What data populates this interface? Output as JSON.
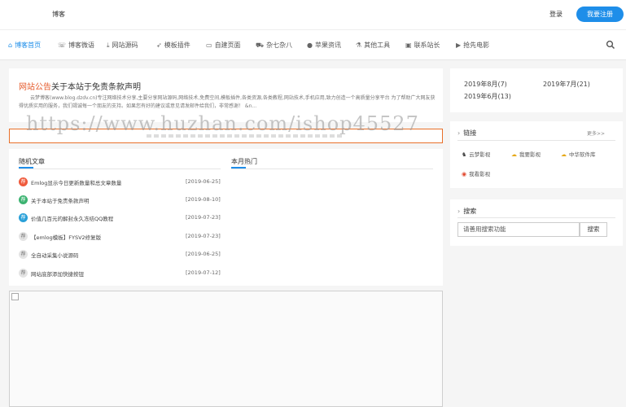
{
  "header": {
    "logo_text": "博客",
    "login_label": "登录",
    "register_label": "我要注册"
  },
  "nav": {
    "items": [
      {
        "label": "博客首页",
        "icon": "home-icon",
        "glyph": "⌂"
      },
      {
        "label": "博客微语",
        "icon": "chat-icon",
        "glyph": "☏"
      },
      {
        "label": "网站源码",
        "icon": "download-icon",
        "glyph": "⤓"
      },
      {
        "label": "模板插件",
        "icon": "send-icon",
        "glyph": "➶"
      },
      {
        "label": "自建页面",
        "icon": "folder-icon",
        "glyph": "▭"
      },
      {
        "label": "杂七杂八",
        "icon": "car-icon",
        "glyph": "⛟"
      },
      {
        "label": "苹果资讯",
        "icon": "apple-icon",
        "glyph": "●"
      },
      {
        "label": "其他工具",
        "icon": "flask-icon",
        "glyph": "⚗"
      },
      {
        "label": "联系站长",
        "icon": "id-card-icon",
        "glyph": "▣"
      },
      {
        "label": "抢先电影",
        "icon": "play-icon",
        "glyph": "▶"
      }
    ]
  },
  "notice": {
    "tag": "网站公告",
    "title": "关于本站于免责条款声明",
    "body": "云梦博客(www.blog.dzdv.cn)专注网络技术分享,主要分享网站源码,网络技术,免费空间,模板插件,各类资源,各类教程,网站技术,手机应用,致力创造一个高质量分享平台 为了帮助广大网友获得优质实用的服务，我们竭诚每一个朋友的支持。如果您有好的建议或意见请发邮件给我们，非常感谢！ &n..."
  },
  "watermark": "https://www.huzhan.com/ishop45527",
  "random_articles": {
    "title": "随机文章",
    "items": [
      {
        "rank": "荐",
        "title": "Emlog显示今日更新数量和总文章数量",
        "date": "[2019-06-25]",
        "color": "red"
      },
      {
        "rank": "荐",
        "title": "关于本站于免责条款声明",
        "date": "[2019-08-10]",
        "color": "green"
      },
      {
        "rank": "荐",
        "title": "价值几百元的解封永久冻结QQ教程",
        "date": "[2019-07-23]",
        "color": "blue"
      },
      {
        "rank": "荐",
        "title": "【emlog模板】FYSV2修复版",
        "date": "[2019-07-23]",
        "color": "gray"
      },
      {
        "rank": "荐",
        "title": "全自动采集小说源码",
        "date": "[2019-06-25]",
        "color": "gray"
      },
      {
        "rank": "荐",
        "title": "网站底部添加快捷按钮",
        "date": "[2019-07-12]",
        "color": "gray"
      }
    ]
  },
  "hot_month": {
    "title": "本月热门"
  },
  "archives": [
    "2019年8月(7)",
    "2019年7月(21)",
    "2019年6月(13)"
  ],
  "links": {
    "title": "链接",
    "more_label": "更多>>",
    "items": [
      {
        "label": "云梦影视",
        "icon": "film-icon",
        "glyph": "♞",
        "color": "#444"
      },
      {
        "label": "我要影视",
        "icon": "cloud-icon",
        "glyph": "☁",
        "color": "#e6a817"
      },
      {
        "label": "中华软件库",
        "icon": "cloud-icon",
        "glyph": "☁",
        "color": "#e6a817"
      },
      {
        "label": "我看影视",
        "icon": "play-circle-icon",
        "glyph": "◉",
        "color": "#e0442a"
      }
    ]
  },
  "search": {
    "title": "搜索",
    "placeholder": "请善用搜索功能",
    "button_label": "搜索"
  },
  "colors": {
    "accent": "#1e8ee9",
    "notice_tag": "#e55a2b",
    "ad_border": "#e8702a"
  }
}
